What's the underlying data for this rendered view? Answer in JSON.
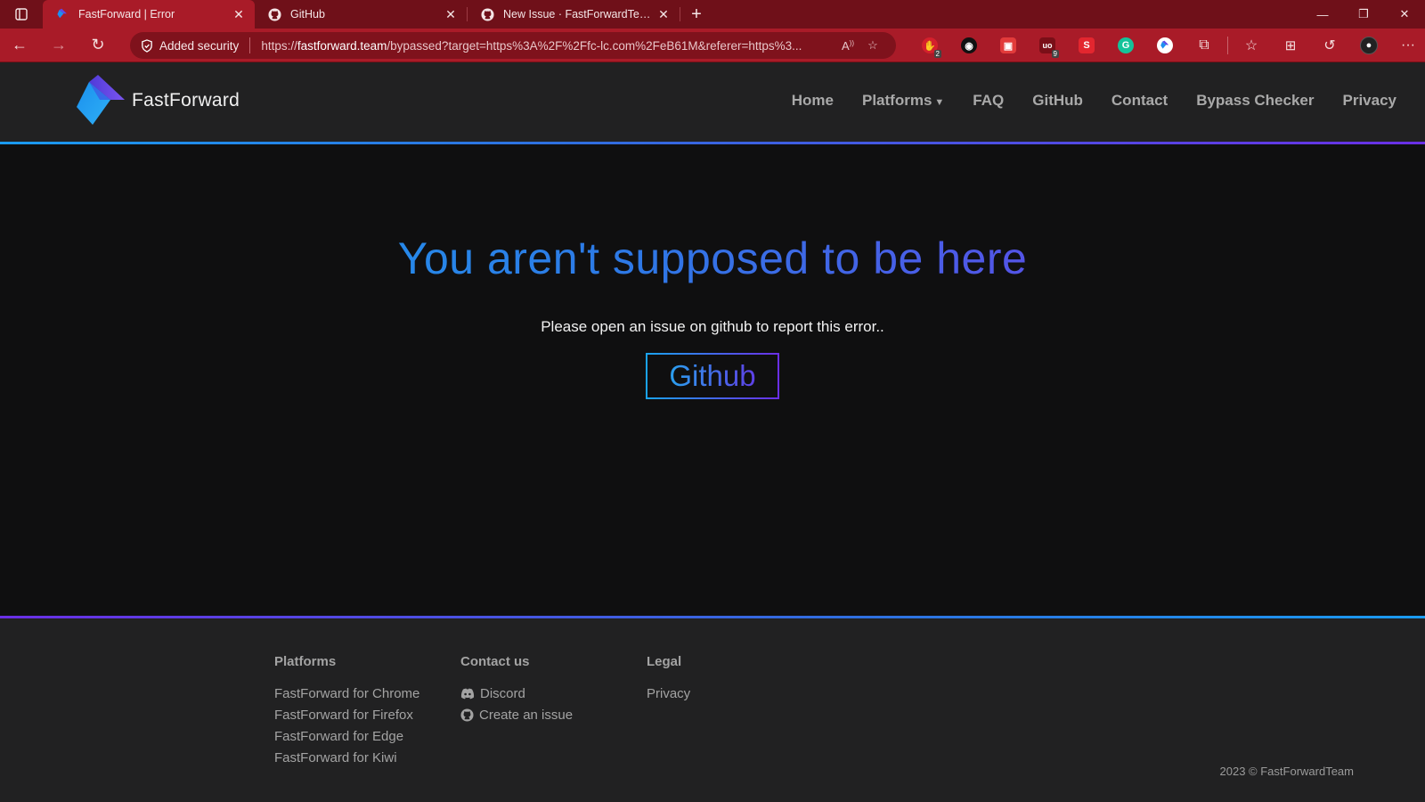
{
  "browser": {
    "tabs": [
      {
        "title": "FastForward | Error",
        "active": true,
        "icon": "fastforward-icon"
      },
      {
        "title": "GitHub",
        "active": false,
        "icon": "github-icon"
      },
      {
        "title": "New Issue · FastForwardTeam/Fa",
        "active": false,
        "icon": "github-icon"
      }
    ],
    "security_label": "Added security",
    "url_prefix": "https://",
    "url_host": "fastforward.team",
    "url_rest": "/bypassed?target=https%3A%2F%2Ffc-lc.com%2FeB61M&referer=https%3...",
    "extension_badges": {
      "adblock": "2",
      "ublock": "9"
    },
    "colors": {
      "tab_strip": "#6f1019",
      "toolbar": "#a91b28"
    }
  },
  "site": {
    "brand": "FastForward",
    "nav": {
      "home": "Home",
      "platforms": "Platforms",
      "faq": "FAQ",
      "github": "GitHub",
      "contact": "Contact",
      "bypass_checker": "Bypass Checker",
      "privacy": "Privacy"
    },
    "accent_gradient": [
      "#1aa3ee",
      "#6a2fe6"
    ]
  },
  "main": {
    "headline": "You aren't supposed to be here",
    "subtext": "Please open an issue on github to report this error..",
    "button_label": "Github"
  },
  "footer": {
    "platforms_heading": "Platforms",
    "platforms": [
      "FastForward for Chrome",
      "FastForward for Firefox",
      "FastForward for Edge",
      "FastForward for Kiwi"
    ],
    "contact_heading": "Contact us",
    "discord": "Discord",
    "create_issue": "Create an issue",
    "legal_heading": "Legal",
    "privacy": "Privacy",
    "copyright": "2023 © FastForwardTeam"
  }
}
